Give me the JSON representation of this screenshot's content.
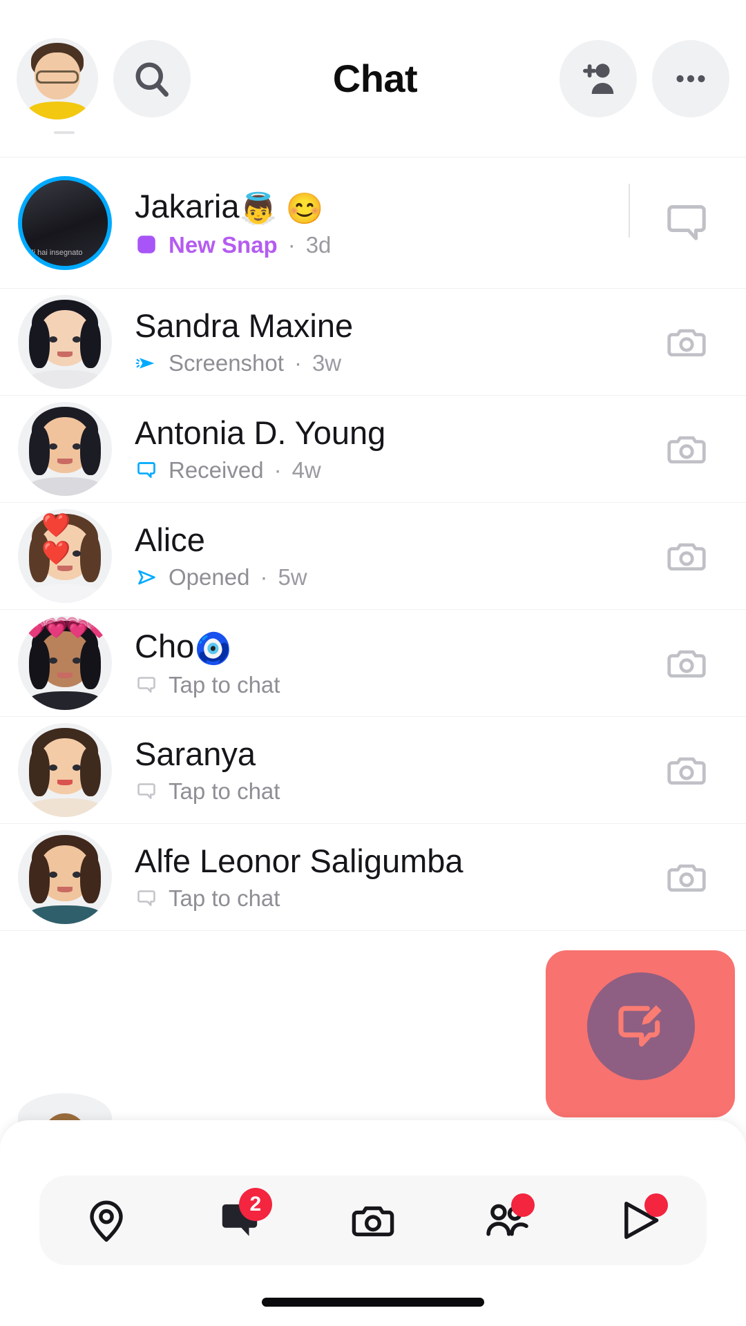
{
  "header": {
    "title": "Chat",
    "profile_avatar_name": "my-bitmoji-avatar",
    "search_icon": "search-icon",
    "add_friend_icon": "add-friend-icon",
    "more_icon": "more-options-icon"
  },
  "chats": [
    {
      "name": "Jakaria",
      "name_emoji": "👼 😊",
      "status": "New Snap",
      "time": "3d",
      "separator": "·",
      "unread": true,
      "status_icon": "new-snap-square-icon",
      "status_color": "#b45cf0",
      "action_icon": "chat-bubble-icon",
      "avatar_ring": true,
      "avatar_kind": "photo",
      "avatar_caption": "Mi hai insegnato"
    },
    {
      "name": "Sandra Maxine",
      "name_emoji": "",
      "status": "Screenshot",
      "time": "3w",
      "separator": "·",
      "unread": false,
      "status_icon": "screenshot-arrow-icon",
      "status_color": "#00aaff",
      "action_icon": "camera-icon",
      "avatar_ring": false,
      "avatar_kind": "bitmoji-black-bob"
    },
    {
      "name": "Antonia D. Young",
      "name_emoji": "",
      "status": "Received",
      "time": "4w",
      "separator": "·",
      "unread": false,
      "status_icon": "received-chat-icon",
      "status_color": "#00aaff",
      "action_icon": "camera-icon",
      "avatar_ring": false,
      "avatar_kind": "bitmoji-dark-long"
    },
    {
      "name": "Alice",
      "name_emoji": "",
      "status": "Opened",
      "time": "5w",
      "separator": "·",
      "unread": false,
      "status_icon": "opened-snap-arrow-icon",
      "status_color": "#00aaff",
      "action_icon": "camera-icon",
      "avatar_ring": false,
      "avatar_kind": "bitmoji-heart-headband"
    },
    {
      "name": "Cho",
      "name_emoji": "🧿",
      "status": "Tap to chat",
      "time": "",
      "separator": "",
      "unread": false,
      "status_icon": "tap-to-chat-icon",
      "status_color": "#c4c4ca",
      "action_icon": "camera-icon",
      "avatar_ring": false,
      "avatar_kind": "bitmoji-pink-hearts"
    },
    {
      "name": "Saranya",
      "name_emoji": "",
      "status": "Tap to chat",
      "time": "",
      "separator": "",
      "unread": false,
      "status_icon": "tap-to-chat-icon",
      "status_color": "#c4c4ca",
      "action_icon": "camera-icon",
      "avatar_ring": false,
      "avatar_kind": "bitmoji-tongue-out"
    },
    {
      "name": "Alfe Leonor Saligumba",
      "name_emoji": "",
      "status": "Tap to chat",
      "time": "",
      "separator": "",
      "unread": false,
      "status_icon": "tap-to-chat-icon",
      "status_color": "#c4c4ca",
      "action_icon": "camera-icon",
      "avatar_ring": false,
      "avatar_kind": "bitmoji-brown-long"
    }
  ],
  "fab": {
    "icon": "new-chat-compose-icon",
    "highlight_color": "#f8726f",
    "button_color": "#8e5f82"
  },
  "bottom_nav": [
    {
      "icon": "map-pin-icon",
      "badge": "",
      "badge_type": "none"
    },
    {
      "icon": "chat-icon",
      "badge": "2",
      "badge_type": "count"
    },
    {
      "icon": "camera-icon",
      "badge": "",
      "badge_type": "none"
    },
    {
      "icon": "friends-icon",
      "badge": "",
      "badge_type": "dot"
    },
    {
      "icon": "stories-play-icon",
      "badge": "",
      "badge_type": "dot"
    }
  ],
  "colors": {
    "accent_blue": "#00aaff",
    "snap_purple": "#b45cf0",
    "badge_red": "#f3253f",
    "text_primary": "#15151a",
    "text_secondary": "#8e8e95"
  }
}
